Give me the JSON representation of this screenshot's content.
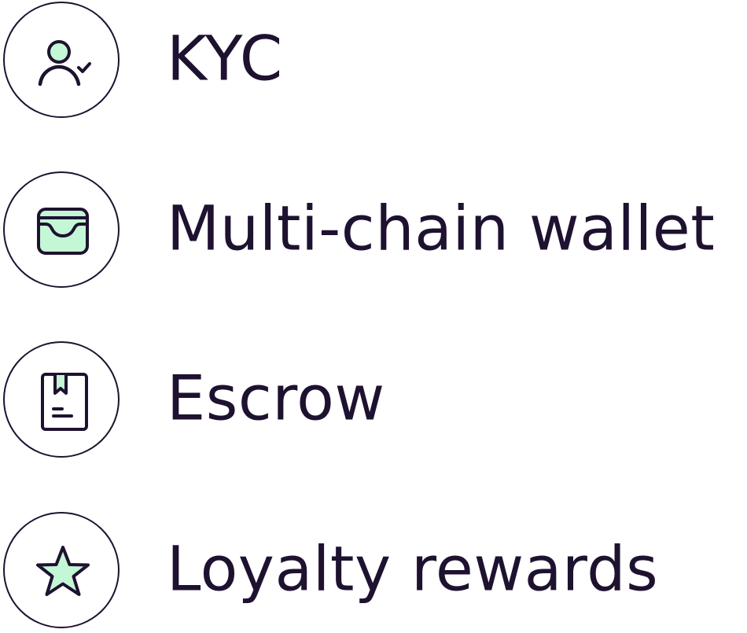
{
  "colors": {
    "ink": "#1e1230",
    "accent": "#c4f7d5",
    "background": "#ffffff"
  },
  "features": [
    {
      "label": "KYC",
      "icon": "user-check-icon"
    },
    {
      "label": "Multi-chain wallet",
      "icon": "wallet-icon"
    },
    {
      "label": "Escrow",
      "icon": "bookmarked-document-icon"
    },
    {
      "label": "Loyalty rewards",
      "icon": "star-icon"
    }
  ]
}
